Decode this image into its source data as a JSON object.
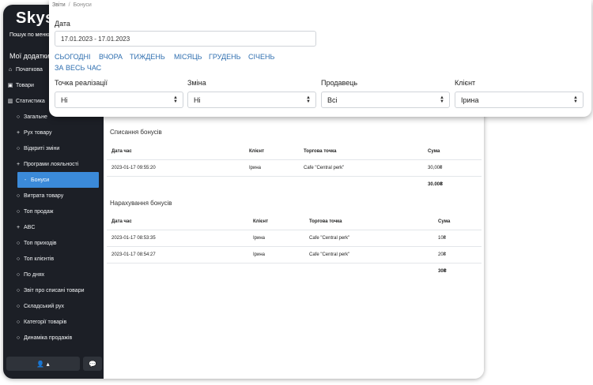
{
  "sidebar": {
    "logo": "Skys",
    "menu_search": "Пошук по меню",
    "my_apps": "Мої додатки",
    "items": [
      {
        "label": "Початкова",
        "icon": "home-icon",
        "glyph": "⌂",
        "level": 1,
        "active": false
      },
      {
        "label": "Товари",
        "icon": "box-icon",
        "glyph": "▣",
        "level": 1,
        "active": false
      },
      {
        "label": "Статистика",
        "icon": "chart-icon",
        "glyph": "▥",
        "level": 1,
        "active": false
      },
      {
        "label": "Загальне",
        "icon": "circle-icon",
        "glyph": "○",
        "level": 2,
        "active": false
      },
      {
        "label": "Рух товару",
        "icon": "plus-icon",
        "glyph": "+",
        "level": 2,
        "active": false
      },
      {
        "label": "Відкриті зміни",
        "icon": "circle-icon",
        "glyph": "○",
        "level": 2,
        "active": false
      },
      {
        "label": "Програми лояльності",
        "icon": "plus-icon",
        "glyph": "+",
        "level": 2,
        "active": false
      },
      {
        "label": "Бонуси",
        "icon": "dash-icon",
        "glyph": "-",
        "level": 3,
        "active": true
      },
      {
        "label": "Витрата товару",
        "icon": "circle-icon",
        "glyph": "○",
        "level": 2,
        "active": false
      },
      {
        "label": "Топ продаж",
        "icon": "circle-icon",
        "glyph": "○",
        "level": 2,
        "active": false
      },
      {
        "label": "ABC",
        "icon": "plus-icon",
        "glyph": "+",
        "level": 2,
        "active": false
      },
      {
        "label": "Топ приходів",
        "icon": "circle-icon",
        "glyph": "○",
        "level": 2,
        "active": false
      },
      {
        "label": "Топ клієнтів",
        "icon": "circle-icon",
        "glyph": "○",
        "level": 2,
        "active": false
      },
      {
        "label": "По днях",
        "icon": "circle-icon",
        "glyph": "○",
        "level": 2,
        "active": false
      },
      {
        "label": "Звіт про списані товари",
        "icon": "circle-icon",
        "glyph": "○",
        "level": 2,
        "active": false
      },
      {
        "label": "Складський рух",
        "icon": "circle-icon",
        "glyph": "○",
        "level": 2,
        "active": false
      },
      {
        "label": "Категорії товарів",
        "icon": "circle-icon",
        "glyph": "○",
        "level": 2,
        "active": false
      },
      {
        "label": "Динаміка продажів",
        "icon": "circle-icon",
        "glyph": "○",
        "level": 2,
        "active": false
      }
    ]
  },
  "writeoffs": {
    "title": "Списання бонусів",
    "headers": [
      "Дата час",
      "Клієнт",
      "Торгова точка",
      "Сума"
    ],
    "rows": [
      [
        "2023-01-17 09:55:20",
        "Ірина",
        "Cafe \"Central perk\"",
        "30,00₴"
      ]
    ],
    "total": "30.00₴"
  },
  "accruals": {
    "title": "Нарахування бонусів",
    "headers": [
      "Дата час",
      "Клієнт",
      "Торгова точка",
      "Сума"
    ],
    "rows": [
      [
        "2023-01-17 08:53:35",
        "Ірина",
        "Cafe \"Central perk\"",
        "10₴"
      ],
      [
        "2023-01-17 08:54:27",
        "Ірина",
        "Cafe \"Central perk\"",
        "20₴"
      ]
    ],
    "total": "30₴"
  },
  "filters": {
    "breadcrumb_root": "Звіти",
    "breadcrumb_sep": "/",
    "breadcrumb_current": "Бонуси",
    "date_label": "Дата",
    "date_value": "17.01.2023 - 17.01.2023",
    "quick_ranges": [
      "СЬОГОДНІ",
      "ВЧОРА",
      "ТИЖДЕНЬ",
      "МІСЯЦЬ",
      "ГРУДЕНЬ",
      "СІЧЕНЬ",
      "ЗА ВЕСЬ ЧАС"
    ],
    "selects": [
      {
        "label": "Точка реалізації",
        "value": "Ні"
      },
      {
        "label": "Зміна",
        "value": "Ні"
      },
      {
        "label": "Продавець",
        "value": "Всі"
      },
      {
        "label": "Клієнт",
        "value": "Ірина"
      }
    ]
  },
  "colors": {
    "sidebar_bg": "#1c1f26",
    "accent": "#3b8ad9",
    "link": "#2f6fb0"
  }
}
